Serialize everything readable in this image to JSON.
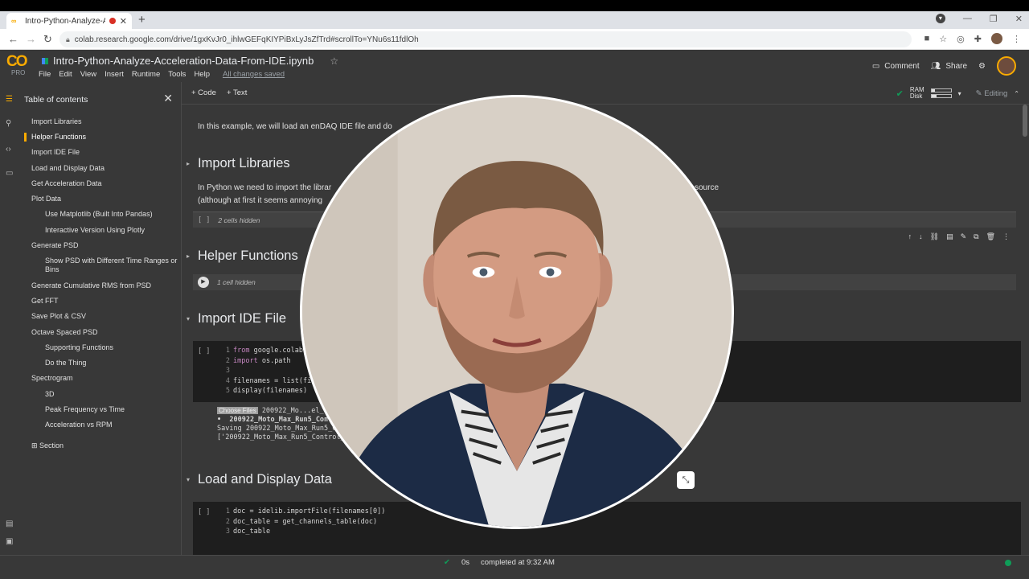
{
  "browser": {
    "tab_title": "Intro-Python-Analyze-Acceleration-Data-From-IDE.ipynb",
    "new_tab": "+",
    "url": "colab.research.google.com/drive/1gxKvJr0_ihlwGEFqKIYPiBxLyJsZfTrd#scrollTo=YNu6s11fdlOh"
  },
  "colab": {
    "logo_text": "CO",
    "pro_label": "PRO",
    "notebook_title": "Intro-Python-Analyze-Acceleration-Data-From-IDE.ipynb",
    "menu": [
      "File",
      "Edit",
      "View",
      "Insert",
      "Runtime",
      "Tools",
      "Help"
    ],
    "saved_status": "All changes saved",
    "comment_label": "Comment",
    "share_label": "Share"
  },
  "toc": {
    "title": "Table of contents",
    "items": [
      {
        "label": "Import Libraries",
        "level": 1
      },
      {
        "label": "Helper Functions",
        "level": 1,
        "active": true
      },
      {
        "label": "Import IDE File",
        "level": 1
      },
      {
        "label": "Load and Display Data",
        "level": 1
      },
      {
        "label": "Get Acceleration Data",
        "level": 1
      },
      {
        "label": "Plot Data",
        "level": 1
      },
      {
        "label": "Use Matplotlib (Built Into Pandas)",
        "level": 2
      },
      {
        "label": "Interactive Version Using Plotly",
        "level": 2
      },
      {
        "label": "Generate PSD",
        "level": 1
      },
      {
        "label": "Show PSD with Different Time Ranges or Bins",
        "level": 2
      },
      {
        "label": "Generate Cumulative RMS from PSD",
        "level": 1
      },
      {
        "label": "Get FFT",
        "level": 1
      },
      {
        "label": "Save Plot & CSV",
        "level": 1
      },
      {
        "label": "Octave Spaced PSD",
        "level": 1
      },
      {
        "label": "Supporting Functions",
        "level": 2
      },
      {
        "label": "Do the Thing",
        "level": 2
      },
      {
        "label": "Spectrogram",
        "level": 1
      },
      {
        "label": "3D",
        "level": 2
      },
      {
        "label": "Peak Frequency vs Time",
        "level": 2
      },
      {
        "label": "Acceleration vs RPM",
        "level": 2
      }
    ],
    "add_section": "Section"
  },
  "toolbar": {
    "add_code": "+ Code",
    "add_text": "+ Text",
    "ram_label": "RAM",
    "disk_label": "Disk",
    "editing_label": "Editing"
  },
  "notebook": {
    "intro": "In this example, we will load an enDAQ IDE file and do",
    "sec_import_libraries": "Import Libraries",
    "import_para_1": "In Python we need to import the librar",
    "import_para_1b": "source",
    "import_para_2": "(although at first it seems annoying",
    "hidden_2": "2 cells hidden",
    "sec_helper": "Helper Functions",
    "hidden_1": "1 cell hidden",
    "sec_import_ide": "Import IDE File",
    "exec_empty": "[ ]",
    "code1": [
      "from google.colab",
      "import os.path",
      "",
      "filenames = list(fil",
      "display(filenames)"
    ],
    "output1": {
      "choose_files": "Choose Files",
      "file_line": "200922_Mo...el_",
      "bullet_line": "•  200922_Moto_Max_Run5_Con",
      "saving_line": "Saving 200922_Moto_Max_Run5_Co",
      "list_line": "['200922_Moto_Max_Run5_Control_"
    },
    "sec_load": "Load and Display Data",
    "code2": [
      "doc = idelib.importFile(filenames[0])",
      "doc_table = get_channels_table(doc)",
      "doc_table"
    ]
  },
  "status": {
    "time": "0s",
    "message": "completed at 9:32 AM"
  },
  "colors": {
    "accent": "#f9ab00",
    "background": "#383838",
    "code_bg": "#1e1e1e",
    "ok": "#0f9d58"
  }
}
